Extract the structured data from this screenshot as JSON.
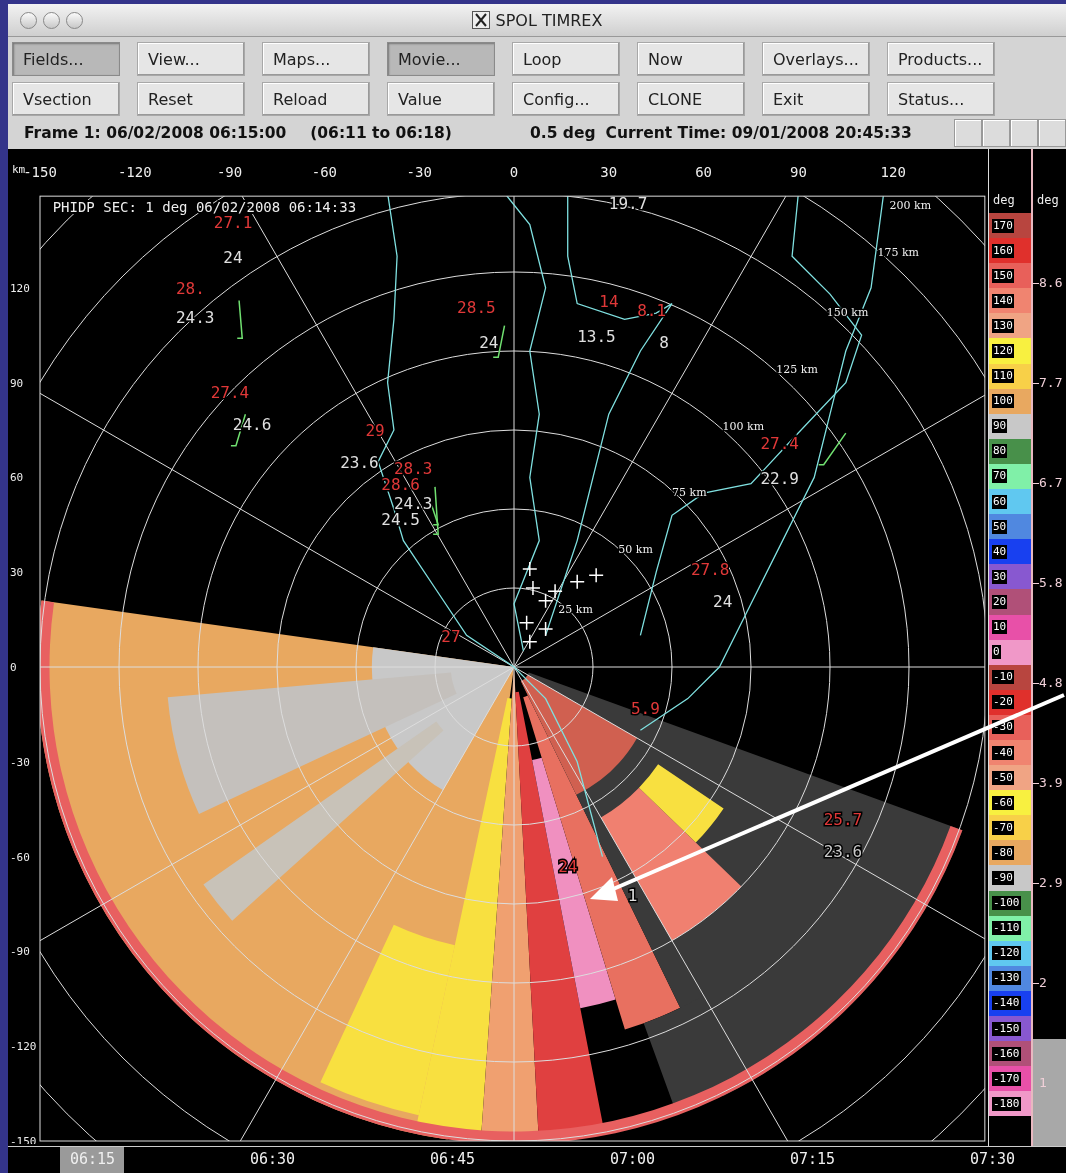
{
  "window": {
    "title": "SPOL TIMREX"
  },
  "toolbar": {
    "buttons": [
      {
        "label": "Fields...",
        "pressed": true
      },
      {
        "label": "View...",
        "pressed": false
      },
      {
        "label": "Maps...",
        "pressed": false
      },
      {
        "label": "Movie...",
        "pressed": true
      },
      {
        "label": "Loop",
        "pressed": false
      },
      {
        "label": "Now",
        "pressed": false
      },
      {
        "label": "Overlays...",
        "pressed": false
      },
      {
        "label": "Products...",
        "pressed": false
      },
      {
        "label": "Vsection",
        "pressed": false
      },
      {
        "label": "Reset",
        "pressed": false
      },
      {
        "label": "Reload",
        "pressed": false
      },
      {
        "label": "Value",
        "pressed": false
      },
      {
        "label": "Config...",
        "pressed": false
      },
      {
        "label": "CLONE",
        "pressed": false
      },
      {
        "label": "Exit",
        "pressed": false
      },
      {
        "label": "Status...",
        "pressed": false
      }
    ]
  },
  "status": {
    "frame": "Frame 1: 06/02/2008 06:15:00",
    "span": "(06:11 to 06:18)",
    "elevation": "0.5 deg",
    "current_time": "Current Time: 09/01/2008 20:45:33"
  },
  "plot": {
    "title": "PHIDP SEC: 1 deg 06/02/2008 06:14:33",
    "axis_unit": "km",
    "x_ticks": [
      "-150",
      "-120",
      "-90",
      "-60",
      "-30",
      "0",
      "30",
      "60",
      "90",
      "120"
    ],
    "y_ticks": [
      "120",
      "90",
      "60",
      "30",
      "0",
      "-30",
      "-60",
      "-90",
      "-120",
      "-150"
    ],
    "range_labels": [
      "25 km",
      "50 km",
      "75 km",
      "100 km",
      "125 km",
      "150 km",
      "175 km",
      "200 km"
    ],
    "station_labels": [
      {
        "text": "27.1",
        "color": "#e03838"
      },
      {
        "text": "24",
        "color": "#e0e0e0"
      },
      {
        "text": "28.",
        "color": "#e03838"
      },
      {
        "text": "24.3",
        "color": "#e0e0e0"
      },
      {
        "text": "27.4",
        "color": "#e03838"
      },
      {
        "text": "24.6",
        "color": "#e0e0e0"
      },
      {
        "text": "28.5",
        "color": "#e03838"
      },
      {
        "text": "24",
        "color": "#e0e0e0"
      },
      {
        "text": "29",
        "color": "#e03838"
      },
      {
        "text": "23.6",
        "color": "#e0e0e0"
      },
      {
        "text": "28.3",
        "color": "#e03838"
      },
      {
        "text": "28.6",
        "color": "#e03838"
      },
      {
        "text": "24.3",
        "color": "#e0e0e0"
      },
      {
        "text": "24.5",
        "color": "#e0e0e0"
      },
      {
        "text": "19.7",
        "color": "#e0e0e0"
      },
      {
        "text": "14",
        "color": "#e03838"
      },
      {
        "text": "8.1",
        "color": "#e03838"
      },
      {
        "text": "13.5",
        "color": "#e0e0e0"
      },
      {
        "text": "8",
        "color": "#e0e0e0"
      },
      {
        "text": "27.4",
        "color": "#e03838"
      },
      {
        "text": "22.9",
        "color": "#e0e0e0"
      },
      {
        "text": "27.8",
        "color": "#e03838"
      },
      {
        "text": "24",
        "color": "#e0e0e0"
      },
      {
        "text": "27",
        "color": "#e03838"
      },
      {
        "text": "5.9",
        "color": "#e03838"
      },
      {
        "text": "25.7",
        "color": "#e03838"
      },
      {
        "text": "23.6",
        "color": "#c8c8c8"
      },
      {
        "text": "24",
        "color": "#e03838"
      },
      {
        "text": "1",
        "color": "#e0e0e0"
      }
    ]
  },
  "color_scale": {
    "unit": "deg",
    "entries": [
      {
        "label": "170",
        "color": "#b8453f"
      },
      {
        "label": "160",
        "color": "#e0302c"
      },
      {
        "label": "150",
        "color": "#e8605a"
      },
      {
        "label": "140",
        "color": "#f08470"
      },
      {
        "label": "130",
        "color": "#f0a484"
      },
      {
        "label": "120",
        "color": "#f8f040"
      },
      {
        "label": "110",
        "color": "#f8d048"
      },
      {
        "label": "100",
        "color": "#e8a860"
      },
      {
        "label": "90",
        "color": "#c8c8c8"
      },
      {
        "label": "80",
        "color": "#48904a"
      },
      {
        "label": "70",
        "color": "#80f0a8"
      },
      {
        "label": "60",
        "color": "#60c8f0"
      },
      {
        "label": "50",
        "color": "#5088e0"
      },
      {
        "label": "40",
        "color": "#1840f0"
      },
      {
        "label": "30",
        "color": "#8858d0"
      },
      {
        "label": "20",
        "color": "#b05078"
      },
      {
        "label": "10",
        "color": "#e850a8"
      },
      {
        "label": "0",
        "color": "#f098c8"
      },
      {
        "label": "-10",
        "color": "#b8453f"
      },
      {
        "label": "-20",
        "color": "#e0302c"
      },
      {
        "label": "-30",
        "color": "#e8605a"
      },
      {
        "label": "-40",
        "color": "#f08470"
      },
      {
        "label": "-50",
        "color": "#f0a484"
      },
      {
        "label": "-60",
        "color": "#f8f040"
      },
      {
        "label": "-70",
        "color": "#f8d048"
      },
      {
        "label": "-80",
        "color": "#e8a860"
      },
      {
        "label": "-90",
        "color": "#c8c8c8"
      },
      {
        "label": "-100",
        "color": "#48904a"
      },
      {
        "label": "-110",
        "color": "#80f0a8"
      },
      {
        "label": "-120",
        "color": "#60c8f0"
      },
      {
        "label": "-130",
        "color": "#5088e0"
      },
      {
        "label": "-140",
        "color": "#1840f0"
      },
      {
        "label": "-150",
        "color": "#8858d0"
      },
      {
        "label": "-160",
        "color": "#b05078"
      },
      {
        "label": "-170",
        "color": "#e850a8"
      },
      {
        "label": "-180",
        "color": "#f098c8"
      }
    ]
  },
  "secondary_scale": {
    "unit": "deg",
    "labels": [
      "8.6",
      "7.7",
      "6.7",
      "5.8",
      "4.8",
      "3.9",
      "2.9",
      "2",
      "1"
    ]
  },
  "time_axis": [
    {
      "label": "06:15",
      "selected": true
    },
    {
      "label": "06:30",
      "selected": false
    },
    {
      "label": "06:45",
      "selected": false
    },
    {
      "label": "07:00",
      "selected": false
    },
    {
      "label": "07:15",
      "selected": false
    },
    {
      "label": "07:30",
      "selected": false
    }
  ]
}
